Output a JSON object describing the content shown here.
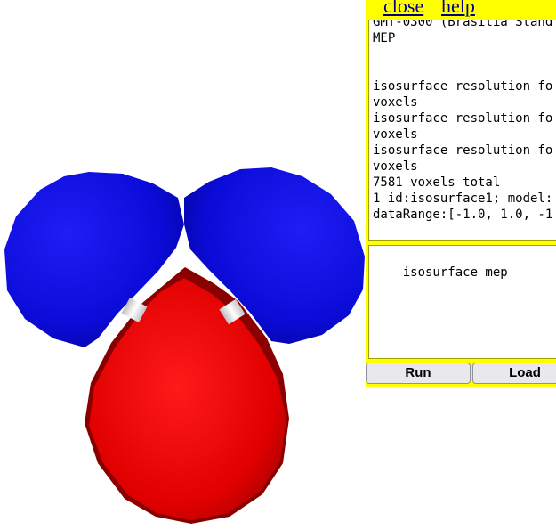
{
  "console": {
    "close_label": "close",
    "help_label": "help",
    "output_lines": [
      "GMT-0300 (Brasilia Stand",
      "MEP",
      "",
      "",
      "isosurface resolution fo",
      "voxels",
      "isosurface resolution fo",
      "voxels",
      "isosurface resolution fo",
      "voxels",
      "7581 voxels total",
      "1 id:isosurface1; model:",
      "dataRange:[-1.0, 1.0, -1"
    ],
    "input_value": "isosurface mep",
    "run_label": "Run",
    "load_label": "Load"
  },
  "colors": {
    "console_bg": "#ffff00",
    "lobe_negative": "#0000ff",
    "lobe_positive": "#ff0000",
    "bond": "#ffffff"
  }
}
